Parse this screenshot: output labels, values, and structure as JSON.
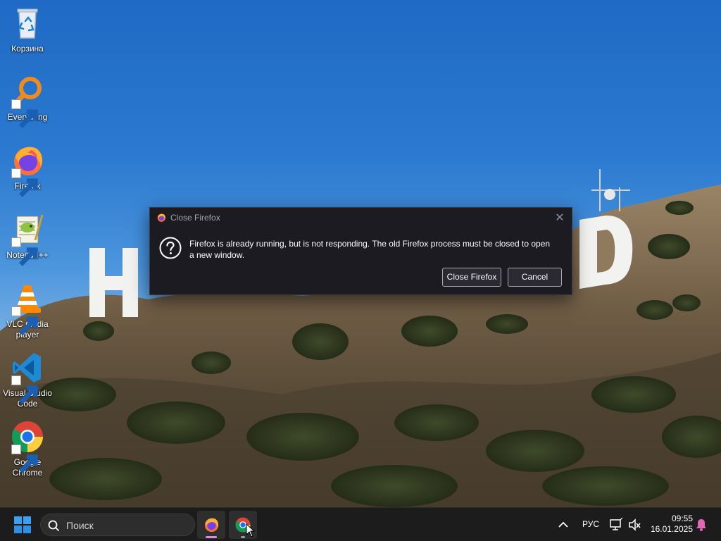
{
  "desktop": {
    "icons": [
      {
        "label": "Корзина",
        "icon": "recycle-bin-icon"
      },
      {
        "label": "Everything",
        "icon": "everything-search-icon"
      },
      {
        "label": "Firefox",
        "icon": "firefox-icon"
      },
      {
        "label": "Notepad++",
        "icon": "notepadpp-icon"
      },
      {
        "label": "VLC media player",
        "icon": "vlc-icon"
      },
      {
        "label": "Visual Studio Code",
        "icon": "vscode-icon"
      },
      {
        "label": "Google Chrome",
        "icon": "chrome-icon"
      }
    ]
  },
  "dialog": {
    "title": "Close Firefox",
    "close_glyph": "✕",
    "message": "Firefox is already running, but is not responding. The old Firefox process must be closed to open a new window.",
    "buttons": {
      "primary": "Close Firefox",
      "secondary": "Cancel"
    }
  },
  "taskbar": {
    "search_placeholder": "Поиск",
    "pinned_apps": [
      "firefox-icon",
      "chrome-icon"
    ],
    "tray": {
      "language": "РУС",
      "time": "09:55",
      "date": "16.01.2025"
    }
  },
  "colors": {
    "dialog_bg": "#1c1b22",
    "taskbar_bg": "#1c1c1c",
    "firefox_running_indicator": "#d68ee0"
  }
}
